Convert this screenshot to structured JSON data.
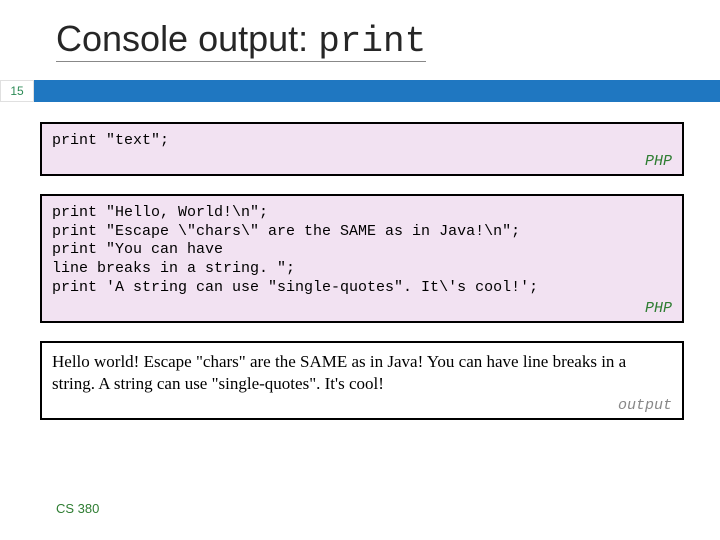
{
  "title": {
    "plain": "Console output: ",
    "mono": "print"
  },
  "page_number": "15",
  "box1": {
    "code": "print \"text\";",
    "lang": "PHP"
  },
  "box2": {
    "code": "print \"Hello, World!\\n\";\nprint \"Escape \\\"chars\\\" are the SAME as in Java!\\n\";\nprint \"You can have\nline breaks in a string. \";\nprint 'A string can use \"single-quotes\". It\\'s cool!';",
    "lang": "PHP"
  },
  "box3": {
    "text": "Hello world!  Escape \"chars\" are the SAME as in Java! You can have line breaks in a string. A string can use \"single-quotes\". It's cool!",
    "label": "output"
  },
  "footer": "CS 380"
}
